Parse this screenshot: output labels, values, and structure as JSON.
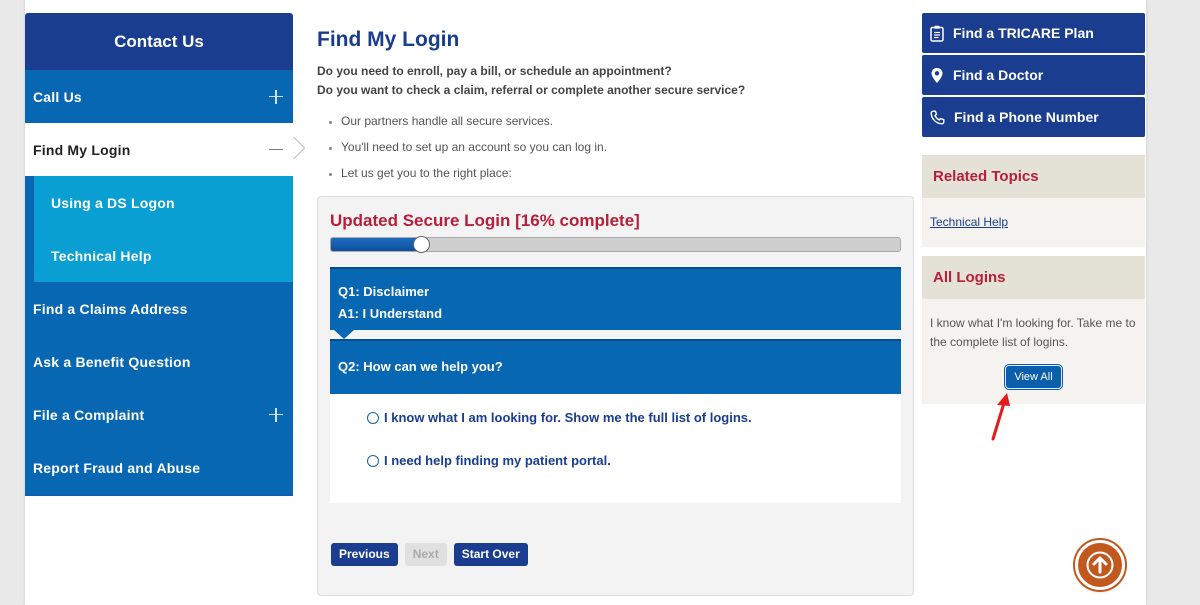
{
  "leftnav": {
    "title": "Contact Us",
    "items": [
      {
        "label": "Call Us"
      },
      {
        "label": "Find My Login"
      },
      {
        "label": "Using a DS Logon"
      },
      {
        "label": "Technical Help"
      },
      {
        "label": "Find a Claims Address"
      },
      {
        "label": "Ask a Benefit Question"
      },
      {
        "label": "File a Complaint"
      },
      {
        "label": "Report Fraud and Abuse"
      }
    ]
  },
  "main": {
    "title": "Find My Login",
    "intro_line1": "Do you need to enroll, pay a bill, or schedule an appointment?",
    "intro_line2": "Do you want to check a claim, referral or complete another secure service?",
    "bullets": [
      "Our partners handle all secure services.",
      "You'll need to set up an account so you can log in.",
      "Let us get you to the right place:"
    ]
  },
  "wizard": {
    "title": "Updated Secure Login [16% complete]",
    "progress": 0.16,
    "q1": "Q1: Disclaimer",
    "a1": "A1: I Understand",
    "q2": "Q2: How can we help you?",
    "options": [
      "I know what I am looking for. Show me the full list of logins.",
      "I need help finding my patient portal."
    ],
    "buttons": {
      "previous": "Previous",
      "next": "Next",
      "start_over": "Start Over"
    }
  },
  "right": {
    "quick_links": [
      {
        "label": "Find a TRICARE Plan",
        "icon": "clipboard-icon"
      },
      {
        "label": "Find a Doctor",
        "icon": "map-pin-icon"
      },
      {
        "label": "Find a Phone Number",
        "icon": "phone-icon"
      }
    ],
    "related_topics": {
      "title": "Related Topics",
      "link": "Technical Help"
    },
    "all_logins": {
      "title": "All Logins",
      "text": "I know what I'm looking for. Take me to the complete list of logins.",
      "button": "View All"
    }
  },
  "colors": {
    "navy": "#1a3d8f",
    "blue": "#0867b3",
    "light_blue": "#0a9fd3",
    "red_heading": "#b51f39",
    "orange": "#c1591f"
  }
}
